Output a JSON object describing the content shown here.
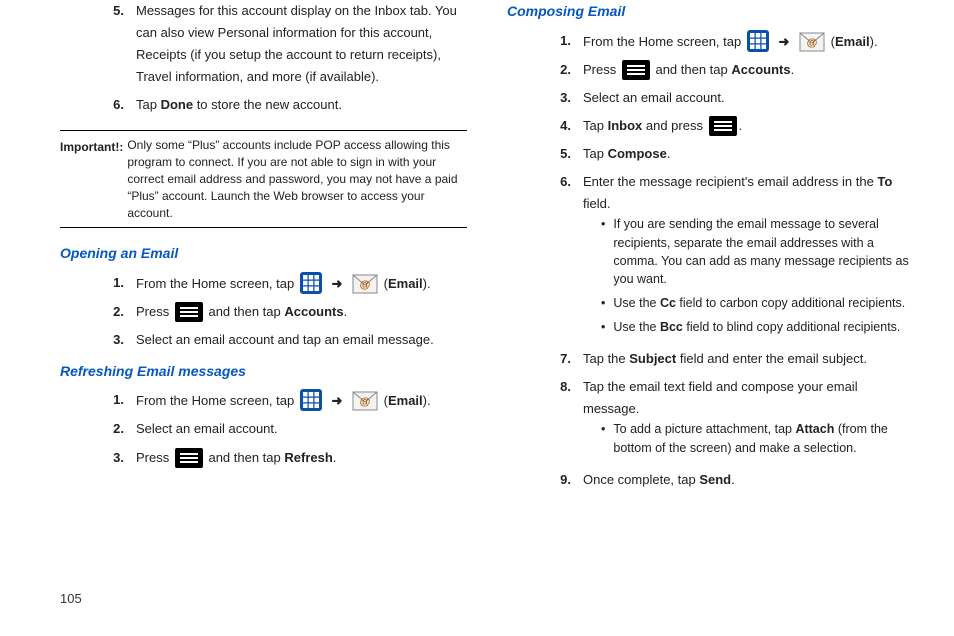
{
  "page_number": "105",
  "left": {
    "cont_list": [
      {
        "num": "5.",
        "text": "Messages for this account display on the Inbox tab. You can also view Personal information for this account, Receipts (if you setup the account to return receipts), Travel information, and more (if available)."
      },
      {
        "num": "6.",
        "pre": "Tap ",
        "bold": "Done",
        "post": " to store the new account."
      }
    ],
    "important_label": "Important!:",
    "important_text": "Only some “Plus” accounts include POP access allowing this program to connect. If you are not able to sign in with your correct email address and password, you may not have a paid “Plus” account. Launch the Web browser to access your account.",
    "heading_open": "Opening an Email",
    "open_list": {
      "n1": "1.",
      "t1a": "From the Home screen, tap ",
      "t1b": "Email",
      "arrow": "➜",
      "n2": "2.",
      "t2a": "Press ",
      "t2b": " and then tap ",
      "t2c": "Accounts",
      "t2d": ".",
      "n3": "3.",
      "t3": "Select an email account and tap an email message."
    },
    "heading_refresh": "Refreshing Email messages",
    "refresh_list": {
      "n1": "1.",
      "t1a": "From the Home screen, tap ",
      "t1b": "Email",
      "arrow": "➜",
      "n2": "2.",
      "t2": "Select an email account.",
      "n3": "3.",
      "t3a": "Press ",
      "t3b": " and then tap ",
      "t3c": "Refresh",
      "t3d": "."
    }
  },
  "right": {
    "heading_compose": "Composing Email",
    "list": {
      "n1": "1.",
      "t1a": "From the Home screen, tap ",
      "t1b": "Email",
      "arrow": "➜",
      "n2": "2.",
      "t2a": "Press ",
      "t2b": " and then tap ",
      "t2c": "Accounts",
      "t2d": ".",
      "n3": "3.",
      "t3": "Select an email account.",
      "n4": "4.",
      "t4a": "Tap ",
      "t4b": "Inbox",
      "t4c": " and press ",
      "t4d": ".",
      "n5": "5.",
      "t5a": "Tap ",
      "t5b": "Compose",
      "t5c": ".",
      "n6": "6.",
      "t6a": "Enter the message recipient's email address in the ",
      "t6b": "To",
      "t6c": " field.",
      "b1": "If you are sending the email message to several recipients, separate the email addresses with a comma. You can add as many message recipients as you want.",
      "b2a": "Use the ",
      "b2b": "Cc",
      "b2c": " field to carbon copy additional recipients.",
      "b3a": "Use the ",
      "b3b": "Bcc",
      "b3c": " field to blind copy additional recipients.",
      "n7": "7.",
      "t7a": "Tap the ",
      "t7b": "Subject",
      "t7c": " field and enter the email subject.",
      "n8": "8.",
      "t8": "Tap the email text field and compose your email message.",
      "b4a": "To add a picture attachment, tap ",
      "b4b": "Attach",
      "b4c": " (from the bottom of the screen) and make a selection.",
      "n9": "9.",
      "t9a": "Once complete, tap ",
      "t9b": "Send",
      "t9c": "."
    }
  }
}
